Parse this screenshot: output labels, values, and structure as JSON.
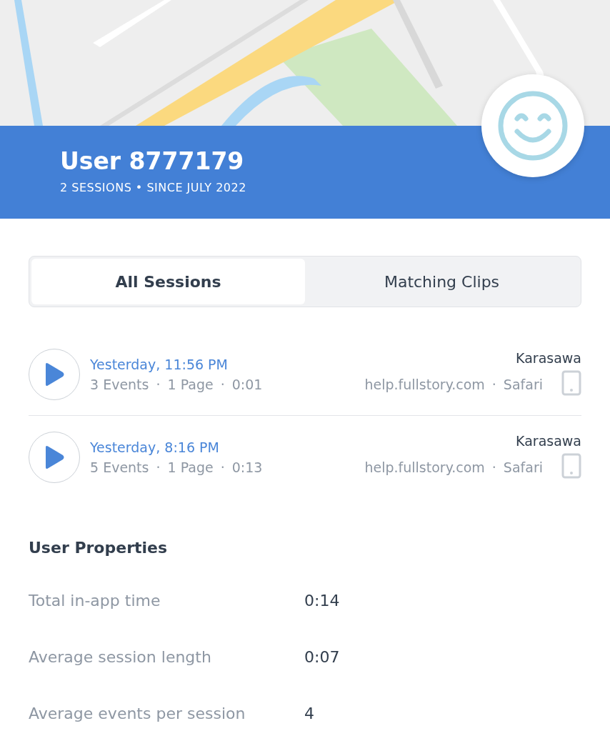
{
  "user": {
    "name": "User 8777179",
    "subtitle": "2 SESSIONS • SINCE JULY 2022"
  },
  "tabs": [
    {
      "label": "All Sessions",
      "selected": true
    },
    {
      "label": "Matching Clips",
      "selected": false
    }
  ],
  "separator": "·",
  "sessions": [
    {
      "time": "Yesterday, 11:56 PM",
      "meta": [
        "3 Events",
        "1 Page",
        "0:01"
      ],
      "location": "Karasawa",
      "details": [
        "help.fullstory.com",
        "Safari"
      ]
    },
    {
      "time": "Yesterday, 8:16 PM",
      "meta": [
        "5 Events",
        "1 Page",
        "0:13"
      ],
      "location": "Karasawa",
      "details": [
        "help.fullstory.com",
        "Safari"
      ]
    }
  ],
  "properties": {
    "title": "User Properties",
    "rows": [
      {
        "label": "Total in-app time",
        "value": "0:14"
      },
      {
        "label": "Average session length",
        "value": "0:07"
      },
      {
        "label": "Average events per session",
        "value": "4"
      }
    ]
  }
}
